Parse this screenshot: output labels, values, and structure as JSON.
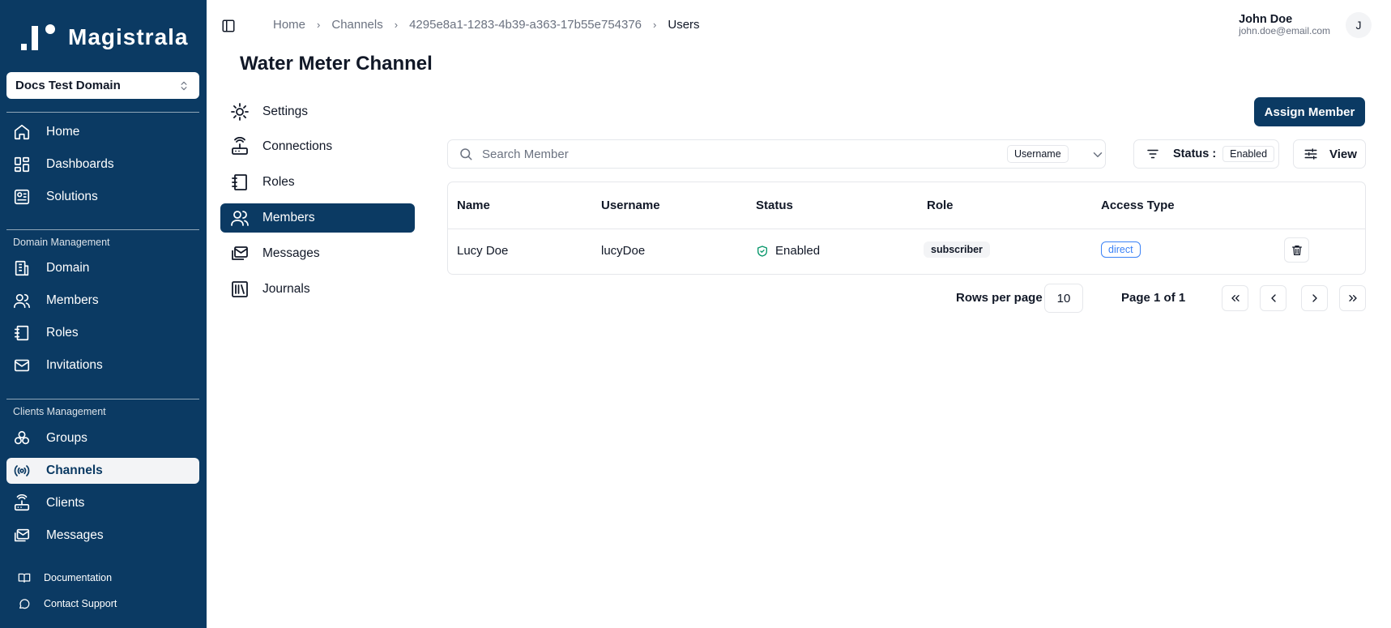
{
  "brand": {
    "name": "Magistrala"
  },
  "domain_selector": {
    "value": "Docs Test Domain"
  },
  "sidebar": {
    "main_items": [
      {
        "label": "Home"
      },
      {
        "label": "Dashboards"
      },
      {
        "label": "Solutions"
      }
    ],
    "domain_management": {
      "label": "Domain Management",
      "items": [
        {
          "label": "Domain"
        },
        {
          "label": "Members"
        },
        {
          "label": "Roles"
        },
        {
          "label": "Invitations"
        }
      ]
    },
    "clients_management": {
      "label": "Clients Management",
      "items": [
        {
          "label": "Groups"
        },
        {
          "label": "Channels"
        },
        {
          "label": "Clients"
        },
        {
          "label": "Messages"
        }
      ]
    },
    "footer_items": [
      {
        "label": "Documentation"
      },
      {
        "label": "Contact Support"
      }
    ],
    "active": "Channels"
  },
  "breadcrumb": {
    "items": [
      "Home",
      "Channels",
      "4295e8a1-1283-4b39-a363-17b55e754376",
      "Users"
    ]
  },
  "user": {
    "name": "John Doe",
    "email": "john.doe@email.com",
    "initial": "J"
  },
  "page": {
    "title": "Water Meter Channel"
  },
  "channel_nav": {
    "items": [
      {
        "label": "Settings"
      },
      {
        "label": "Connections"
      },
      {
        "label": "Roles"
      },
      {
        "label": "Members"
      },
      {
        "label": "Messages"
      },
      {
        "label": "Journals"
      }
    ],
    "active": "Members"
  },
  "toolbar": {
    "assign_label": "Assign Member",
    "search_placeholder": "Search Member",
    "search_type": "Username",
    "status_label": "Status :",
    "status_value": "Enabled",
    "view_label": "View"
  },
  "table": {
    "columns": [
      "Name",
      "Username",
      "Status",
      "Role",
      "Access Type"
    ],
    "rows": [
      {
        "name": "Lucy Doe",
        "username": "lucyDoe",
        "status": "Enabled",
        "role": "subscriber",
        "access_type": "direct"
      }
    ]
  },
  "pagination": {
    "rows_label": "Rows per page",
    "rows_value": "10",
    "page_label": "Page 1 of 1"
  },
  "colors": {
    "brand": "#0b3a63",
    "success": "#059669",
    "link": "#3b82f6"
  }
}
